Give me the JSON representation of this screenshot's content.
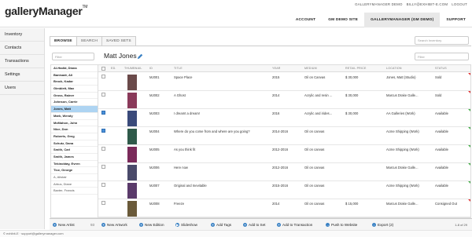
{
  "app": {
    "logo": "galleryManager",
    "logo_tm": "TM"
  },
  "user_links": [
    "GALLERYMANAGER DEMO",
    "BILLY@EXHIBIT-E.COM",
    "LOGOUT"
  ],
  "top_nav": [
    "ACCOUNT",
    "GM DEMO SITE",
    "GALLERYMANAGER (GM DEMO)",
    "SUPPORT"
  ],
  "sidebar": [
    "Inventory",
    "Contacts",
    "Transactions",
    "Settings",
    "Users"
  ],
  "tabs": [
    "BROWSE",
    "SEARCH",
    "SAVED SETS"
  ],
  "search_inventory_placeholder": "Search Inventory",
  "filter_placeholder": "Filter",
  "artist_title": "Matt Jones",
  "artists": [
    "Al-Hadid, Diana",
    "Banisadr, Ali",
    "Brock, Kadar",
    "Gimblett, Max",
    "Gross, Rainer",
    "Johnson, Carrie",
    "Jones, Matt",
    "Mark, Wendy",
    "McMahon, John",
    "Nice, Don",
    "Roberts, Greg",
    "Schutz, Dana",
    "Smith, Carl",
    "Smith, James",
    "Tekinoktay, Evren",
    "Tice, George",
    "A, Alistair",
    "Arbus, Diane",
    "Baxter, Francis"
  ],
  "columns": [
    "ED.",
    "THUMBNAIL",
    "ID",
    "TITLE",
    "YEAR",
    "MEDIUM",
    "RETAIL PRICE",
    "LOCATION",
    "STATUS"
  ],
  "rows": [
    {
      "id": "MJ001",
      "title": "Space Place",
      "year": "2015",
      "medium": "Oil on Canvas",
      "price": "$ 30,000",
      "location": "Jones, Matt (Studio)",
      "status": "Sold",
      "checked": false,
      "flag": "red",
      "thumb": "#6a4a4a"
    },
    {
      "id": "MJ002",
      "title": "A Ghost",
      "year": "2014",
      "medium": "Acrylic and resin ...",
      "price": "$ 30,000",
      "location": "Marcus Drake Galle...",
      "status": "Sold",
      "checked": false,
      "flag": "red",
      "thumb": "#8a3a5a"
    },
    {
      "id": "MJ003",
      "title": "I dreamt a dream!",
      "year": "2016",
      "medium": "Acrylic and irides...",
      "price": "$ 30,000",
      "location": "AA Galleries (Work)",
      "status": "Available",
      "checked": true,
      "flag": "green",
      "thumb": "#3a4a7a"
    },
    {
      "id": "MJ004",
      "title": "Where do you come from and where are you going?",
      "year": "2014-2016",
      "medium": "Oil on canvas",
      "price": "",
      "location": "Acme Shipping (Work)",
      "status": "Available",
      "checked": true,
      "flag": "green",
      "thumb": "#2f5a4a"
    },
    {
      "id": "MJ005",
      "title": "As you think fit",
      "year": "2012-2016",
      "medium": "Oil on canvas",
      "price": "",
      "location": "Acme Shipping (Work)",
      "status": "Available",
      "checked": false,
      "flag": "green",
      "thumb": "#7a2a5a"
    },
    {
      "id": "MJ006",
      "title": "Here now",
      "year": "2012-2016",
      "medium": "Oil on canvas",
      "price": "",
      "location": "Marcus Drake Galle...",
      "status": "Available",
      "checked": false,
      "flag": "green",
      "thumb": "#4a4a6a"
    },
    {
      "id": "MJ007",
      "title": "Original and Inevitable",
      "year": "2015-2016",
      "medium": "Oil on canvas",
      "price": "",
      "location": "Acme Shipping (Work)",
      "status": "Available",
      "checked": false,
      "flag": "green",
      "thumb": "#5a3a6a"
    },
    {
      "id": "MJ008",
      "title": "Freeze",
      "year": "2014",
      "medium": "Oil on canvas",
      "price": "$ 15,000",
      "location": "Marcus Drake Galle...",
      "status": "Consigned Out",
      "checked": false,
      "flag": "red",
      "thumb": "#6a5a3a"
    }
  ],
  "toolbar": {
    "new_artist": "New Artist",
    "new_artist_count": "93",
    "new_artwork": "New Artwork",
    "new_edition": "New Edition",
    "slideshow": "Slideshow",
    "add_tags": "Add Tags",
    "add_to_set": "Add to Set",
    "add_to_transaction": "Add to Transaction",
    "push_to_website": "Push to Website",
    "export": "Export (2)",
    "pager": "1-8 of 29"
  },
  "footer": "© exhibit-E · support@gallerymanager.com",
  "colors": {
    "selected_row": "#aed4f2",
    "accent": "#3b82c4",
    "flag_red": "#e03a3a",
    "flag_green": "#4caf50"
  }
}
